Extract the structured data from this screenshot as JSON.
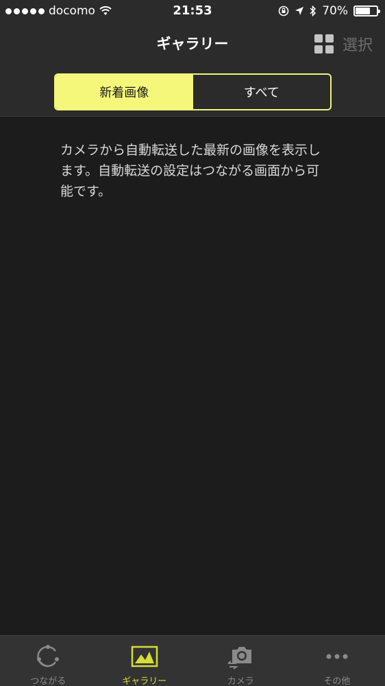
{
  "status_bar": {
    "carrier": "docomo",
    "time": "21:53",
    "battery_percent": "70%",
    "battery_level": 0.7
  },
  "nav": {
    "title": "ギャラリー",
    "select_label": "選択"
  },
  "segments": [
    {
      "label": "新着画像",
      "selected": true
    },
    {
      "label": "すべて",
      "selected": false
    }
  ],
  "message": "カメラから自動転送した最新の画像を表示します。自動転送の設定はつながる画面から可能です。",
  "tabs": [
    {
      "label": "つながる",
      "icon": "connect-icon"
    },
    {
      "label": "ギャラリー",
      "icon": "gallery-icon",
      "active": true
    },
    {
      "label": "カメラ",
      "icon": "camera-icon"
    },
    {
      "label": "その他",
      "icon": "more-icon"
    }
  ],
  "colors": {
    "accent": "#f4f77a",
    "active_tab": "#d6dc3a",
    "background": "#1c1c1c",
    "header": "#2b2b2b"
  }
}
